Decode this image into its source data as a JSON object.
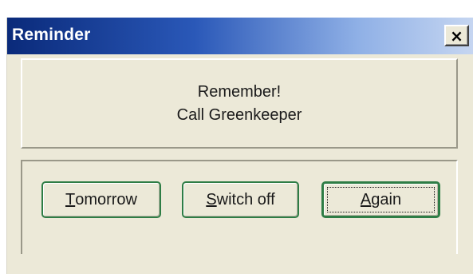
{
  "window": {
    "title": "Reminder",
    "close_glyph": "×",
    "close_icon": "close-icon"
  },
  "message": {
    "line1": "Remember!",
    "line2": "Call Greenkeeper"
  },
  "buttons": {
    "tomorrow": {
      "accel": "T",
      "rest": "omorrow"
    },
    "switch_off": {
      "accel": "S",
      "rest": "witch off"
    },
    "again": {
      "accel": "A",
      "rest": "gain",
      "focused": true
    }
  },
  "colors": {
    "title_gradient_start": "#0a2a7a",
    "title_gradient_end": "#c6d6f1",
    "title_text": "#ffffff",
    "button_border": "#2e7d45",
    "window_background": "#ece9d8"
  }
}
